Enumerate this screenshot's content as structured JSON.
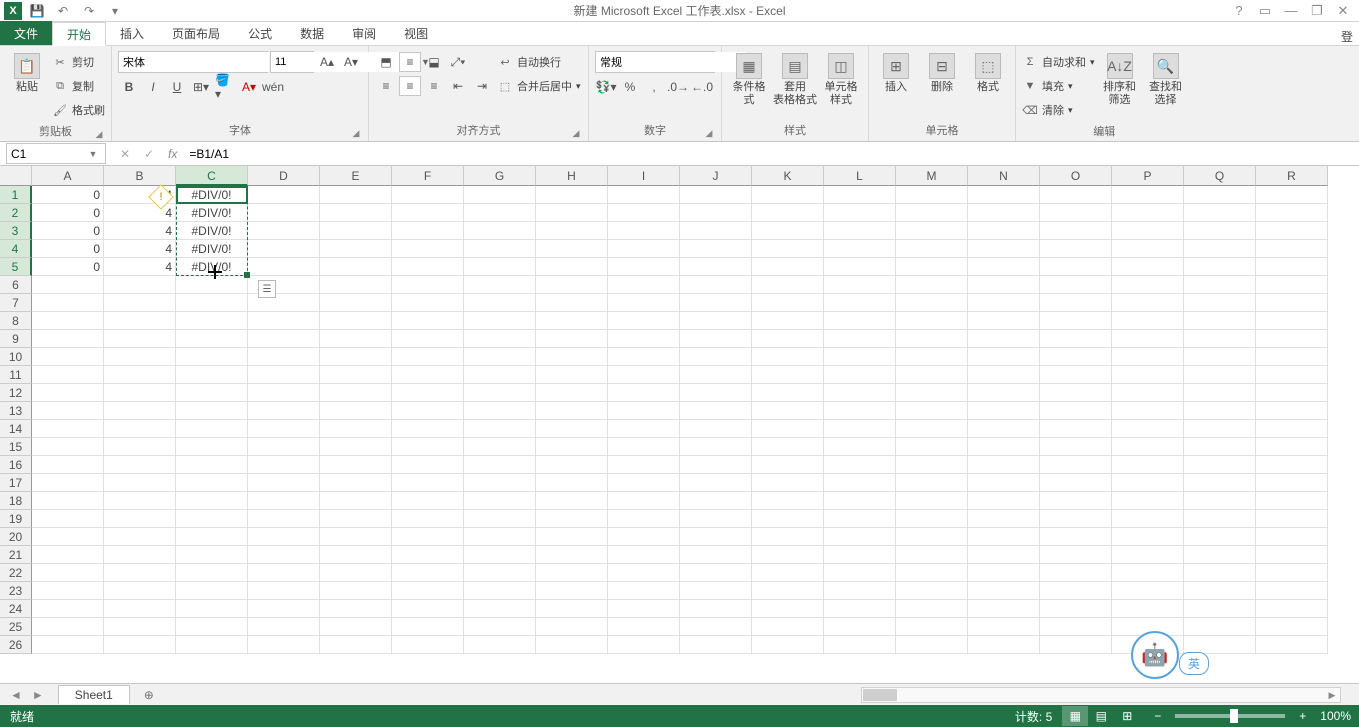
{
  "title": "新建 Microsoft Excel 工作表.xlsx - Excel",
  "qat": {
    "save": "💾",
    "undo": "↶",
    "redo": "↷",
    "more": "▾"
  },
  "win": {
    "help": "?",
    "ribbon_opts": "▭",
    "min": "—",
    "restore": "❐",
    "close": "✕"
  },
  "tabs": {
    "file": "文件",
    "items": [
      "开始",
      "插入",
      "页面布局",
      "公式",
      "数据",
      "审阅",
      "视图"
    ],
    "active": 0,
    "signin": "登"
  },
  "ribbon": {
    "clipboard": {
      "paste": "粘贴",
      "cut": "剪切",
      "copy": "复制",
      "painter": "格式刷",
      "label": "剪贴板"
    },
    "font": {
      "name": "宋体",
      "size": "11",
      "bold": "B",
      "italic": "I",
      "underline": "U",
      "wen": "wén",
      "label": "字体"
    },
    "align": {
      "wrap": "自动换行",
      "merge": "合并后居中",
      "label": "对齐方式"
    },
    "number": {
      "format": "常规",
      "label": "数字"
    },
    "styles": {
      "cond": "条件格式",
      "table": "套用\n表格格式",
      "cell": "单元格样式",
      "label": "样式"
    },
    "cells": {
      "insert": "插入",
      "delete": "删除",
      "format": "格式",
      "label": "单元格"
    },
    "editing": {
      "sum": "自动求和",
      "fill": "填充",
      "clear": "清除",
      "sort": "排序和筛选",
      "find": "查找和选择",
      "label": "编辑"
    }
  },
  "namebox": "C1",
  "formula": "=B1/A1",
  "columns": [
    "A",
    "B",
    "C",
    "D",
    "E",
    "F",
    "G",
    "H",
    "I",
    "J",
    "K",
    "L",
    "M",
    "N",
    "O",
    "P",
    "Q",
    "R"
  ],
  "rows_count": 26,
  "data": {
    "A": [
      "0",
      "0",
      "0",
      "0",
      "0"
    ],
    "B": [
      "4",
      "4",
      "4",
      "4",
      "4"
    ],
    "C": [
      "#DIV/0!",
      "#DIV/0!",
      "#DIV/0!",
      "#DIV/0!",
      "#DIV/0!"
    ]
  },
  "selection": {
    "col": "C",
    "rows": [
      1,
      5
    ]
  },
  "sheet": {
    "name": "Sheet1",
    "add": "⊕"
  },
  "status": {
    "ready": "就绪",
    "count_label": "计数:",
    "count": "5",
    "zoom": "100%"
  },
  "assist_lang": "英"
}
